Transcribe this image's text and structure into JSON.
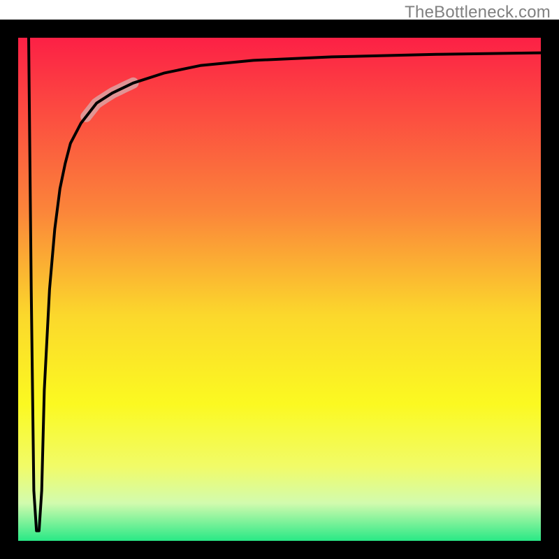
{
  "attribution": "TheBottleneck.com",
  "chart_data": {
    "type": "line",
    "title": "",
    "xlabel": "",
    "ylabel": "",
    "xlim": [
      0,
      100
    ],
    "ylim": [
      0,
      100
    ],
    "grid": false,
    "legend": false,
    "gradient_stops": [
      {
        "offset": 0,
        "color": "#fc1b46"
      },
      {
        "offset": 35,
        "color": "#fb853a"
      },
      {
        "offset": 55,
        "color": "#fbd82c"
      },
      {
        "offset": 72,
        "color": "#fbf921"
      },
      {
        "offset": 84,
        "color": "#f1fb68"
      },
      {
        "offset": 91,
        "color": "#d2fbae"
      },
      {
        "offset": 100,
        "color": "#00e47c"
      }
    ],
    "series": [
      {
        "name": "bottleneck-curve",
        "x": [
          2,
          2.5,
          3,
          3.5,
          4,
          4.5,
          5,
          6,
          7,
          8,
          9,
          10,
          12,
          15,
          18,
          22,
          28,
          35,
          45,
          60,
          80,
          100
        ],
        "y": [
          100,
          50,
          10,
          2,
          2,
          10,
          30,
          50,
          62,
          70,
          75,
          79,
          83,
          87,
          89,
          91,
          93,
          94.5,
          95.5,
          96.2,
          96.7,
          97
        ]
      }
    ],
    "highlight_range": {
      "x_start": 13,
      "x_end": 22
    }
  }
}
